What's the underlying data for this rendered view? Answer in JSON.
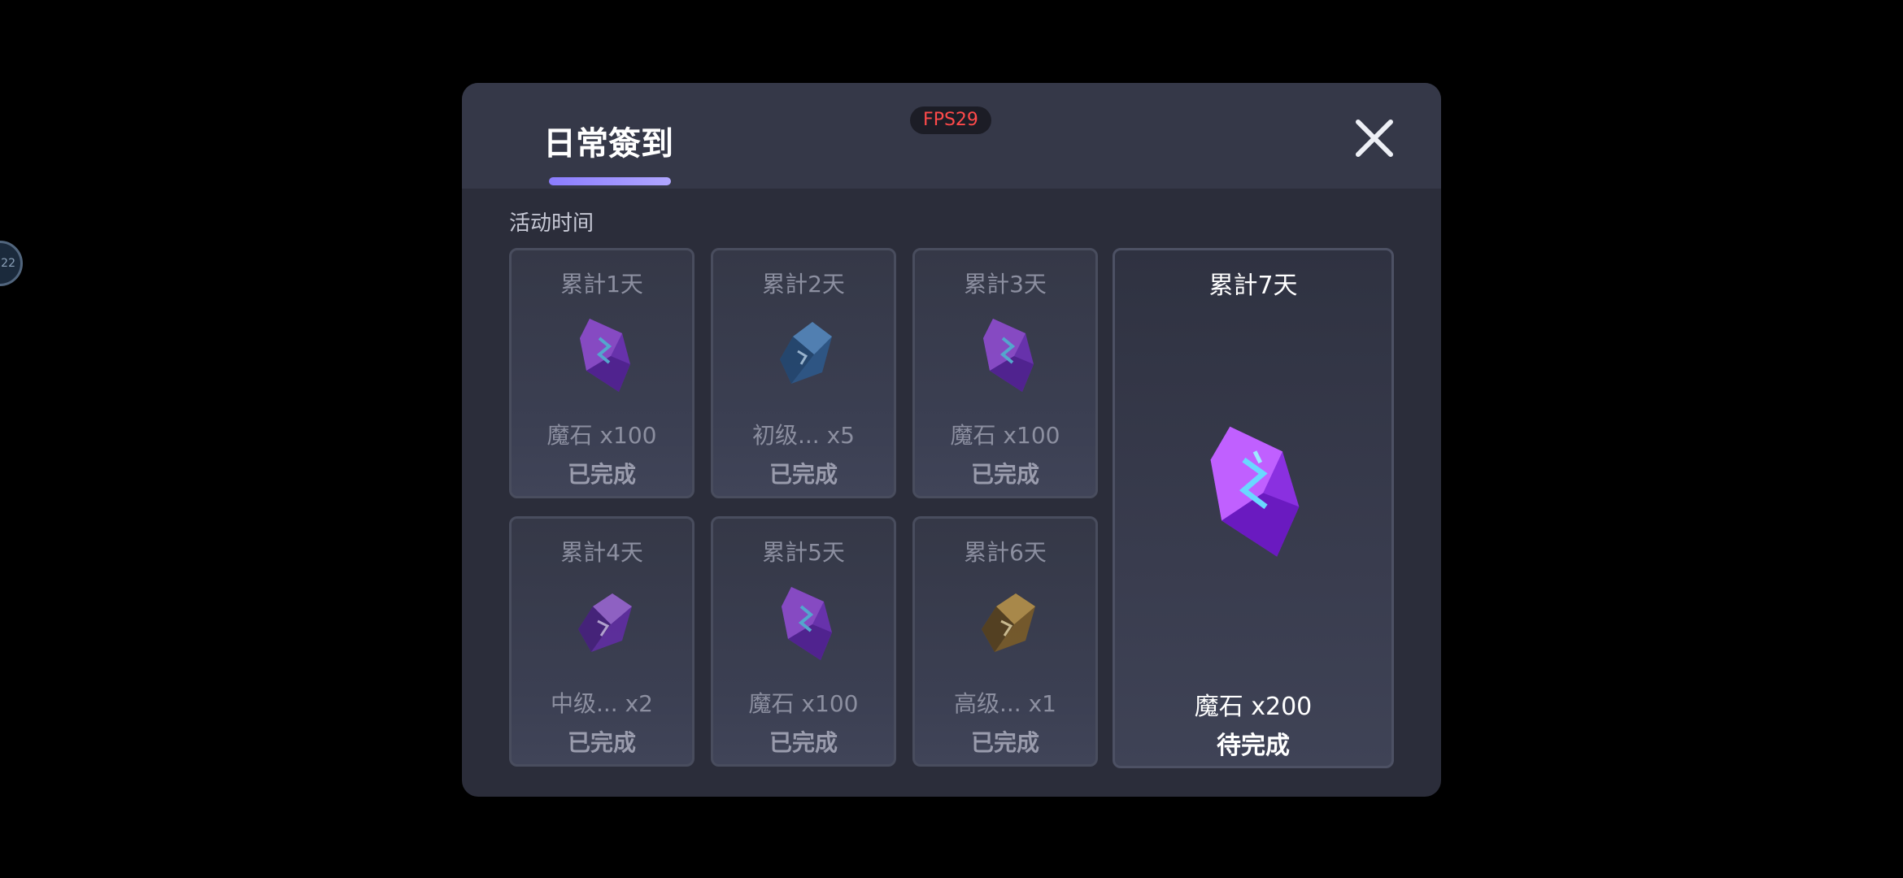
{
  "floating_button": {
    "label": "22"
  },
  "dialog": {
    "title": "日常簽到",
    "fps": "FPS29",
    "activity_time_label": "活动时间",
    "rewards": [
      {
        "day": "累計1天",
        "item": "魔石 x100",
        "status": "已完成",
        "icon": "purple-magic-stone-icon"
      },
      {
        "day": "累計2天",
        "item": "初级... x5",
        "status": "已完成",
        "icon": "blue-crystal-icon"
      },
      {
        "day": "累計3天",
        "item": "魔石 x100",
        "status": "已完成",
        "icon": "purple-magic-stone-icon"
      },
      {
        "day": "累計4天",
        "item": "中级... x2",
        "status": "已完成",
        "icon": "purple-crystal-icon"
      },
      {
        "day": "累計5天",
        "item": "魔石 x100",
        "status": "已完成",
        "icon": "purple-magic-stone-icon"
      },
      {
        "day": "累計6天",
        "item": "高级... x1",
        "status": "已完成",
        "icon": "gold-crystal-icon"
      }
    ],
    "final_reward": {
      "day": "累計7天",
      "item": "魔石 x200",
      "status": "待完成",
      "icon": "purple-magic-stone-icon"
    }
  },
  "colors": {
    "accent": "#9b8cff",
    "fps_text": "#ff4a4a",
    "dialog_bg": "#2b2d3a",
    "header_bg": "#353848"
  }
}
